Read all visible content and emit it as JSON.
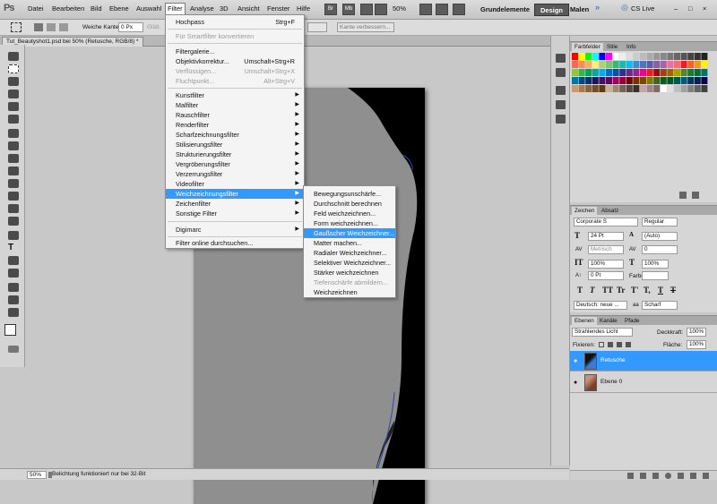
{
  "app": {
    "logo": "Ps"
  },
  "menubar": {
    "items": [
      "Datei",
      "Bearbeiten",
      "Bild",
      "Ebene",
      "Auswahl",
      "Filter",
      "Analyse",
      "3D",
      "Ansicht",
      "Fenster",
      "Hilfe"
    ],
    "br": "Br",
    "mb": "Mb",
    "zoom": "50%",
    "workspaces": {
      "basics": "Grundelemente",
      "design": "Design",
      "paint": "Malen"
    },
    "cs_live": "CS Live",
    "window_controls": [
      "–",
      "□",
      "×"
    ]
  },
  "options": {
    "feather_label": "Weiche Kante:",
    "feather_value": "0 Px",
    "antialias": "Glätt.",
    "refine_edge": "Kante verbessern..."
  },
  "document": {
    "tab_title": "Tut_Beautyshot1.psd bei 50% (Retusche, RGB/8) *"
  },
  "status": {
    "zoom": "50%",
    "message": "Belichtung funktioniert nur bei 32-Bit"
  },
  "filter_menu": {
    "items": [
      {
        "label": "Hochpass",
        "shortcut": "Strg+F"
      },
      {
        "label": "Für Smartfilter konvertieren",
        "disabled": true
      },
      {
        "label": "Filtergalerie..."
      },
      {
        "label": "Objektivkorrektur...",
        "shortcut": "Umschalt+Strg+R"
      },
      {
        "label": "Verflüssigen...",
        "shortcut": "Umschalt+Strg+X",
        "disabled": true
      },
      {
        "label": "Fluchtpunkt...",
        "shortcut": "Alt+Strg+V",
        "disabled": true
      },
      {
        "label": "Kunstfilter",
        "sub": true
      },
      {
        "label": "Malfilter",
        "sub": true
      },
      {
        "label": "Rauschfilter",
        "sub": true
      },
      {
        "label": "Renderfilter",
        "sub": true
      },
      {
        "label": "Scharfzeichnungsfilter",
        "sub": true
      },
      {
        "label": "Stilisierungsfilter",
        "sub": true
      },
      {
        "label": "Strukturierungsfilter",
        "sub": true
      },
      {
        "label": "Vergröberungsfilter",
        "sub": true
      },
      {
        "label": "Verzerrungsfilter",
        "sub": true
      },
      {
        "label": "Videofilter",
        "sub": true
      },
      {
        "label": "Weichzeichnungsfilter",
        "sub": true,
        "highlighted": true
      },
      {
        "label": "Zeichenfilter",
        "sub": true
      },
      {
        "label": "Sonstige Filter",
        "sub": true
      },
      {
        "label": "Digimarc",
        "sub": true
      },
      {
        "label": "Filter online durchsuchen..."
      }
    ]
  },
  "blur_submenu": {
    "items": [
      {
        "label": "Bewegungsunschärfe..."
      },
      {
        "label": "Durchschnitt berechnen"
      },
      {
        "label": "Feld weichzeichnen..."
      },
      {
        "label": "Form weichzeichnen..."
      },
      {
        "label": "Gaußscher Weichzeichner...",
        "highlighted": true
      },
      {
        "label": "Matter machen..."
      },
      {
        "label": "Radialer Weichzeichner..."
      },
      {
        "label": "Selektiver Weichzeichner..."
      },
      {
        "label": "Stärker weichzeichnen"
      },
      {
        "label": "Tiefenschärfe abmildern...",
        "disabled": true
      },
      {
        "label": "Weichzeichnen"
      }
    ]
  },
  "swatches_panel": {
    "tabs": [
      "Farbfelder",
      "Stile",
      "Info"
    ]
  },
  "character_panel": {
    "tabs": [
      "Zeichen",
      "Absatz"
    ],
    "font": "Corporate S",
    "style": "Regular",
    "size": "24 Pt",
    "leading": "(Auto)",
    "kerning": "Metrisch",
    "tracking": "0",
    "vscale": "100%",
    "hscale": "100%",
    "baseline": "0 Pt",
    "color_label": "Farbe:",
    "styles": [
      "T",
      "T",
      "TT",
      "Tr",
      "T'",
      "T,",
      "T",
      "T"
    ],
    "language": "Deutsch: neue ...",
    "aa_label": "aa",
    "aa": "Scharf"
  },
  "layers_panel": {
    "tabs": [
      "Ebenen",
      "Kanäle",
      "Pfade"
    ],
    "blend_mode": "Strahlendes Licht",
    "opacity_label": "Deckkraft:",
    "opacity": "100%",
    "lock_label": "Fixieren:",
    "fill_label": "Fläche:",
    "fill": "100%",
    "layers": [
      {
        "name": "Retusche",
        "selected": true
      },
      {
        "name": "Ebene 0",
        "selected": false
      }
    ]
  },
  "colors": {
    "highlight": "#3399ff",
    "workspace_active": "#5a5a5a"
  }
}
